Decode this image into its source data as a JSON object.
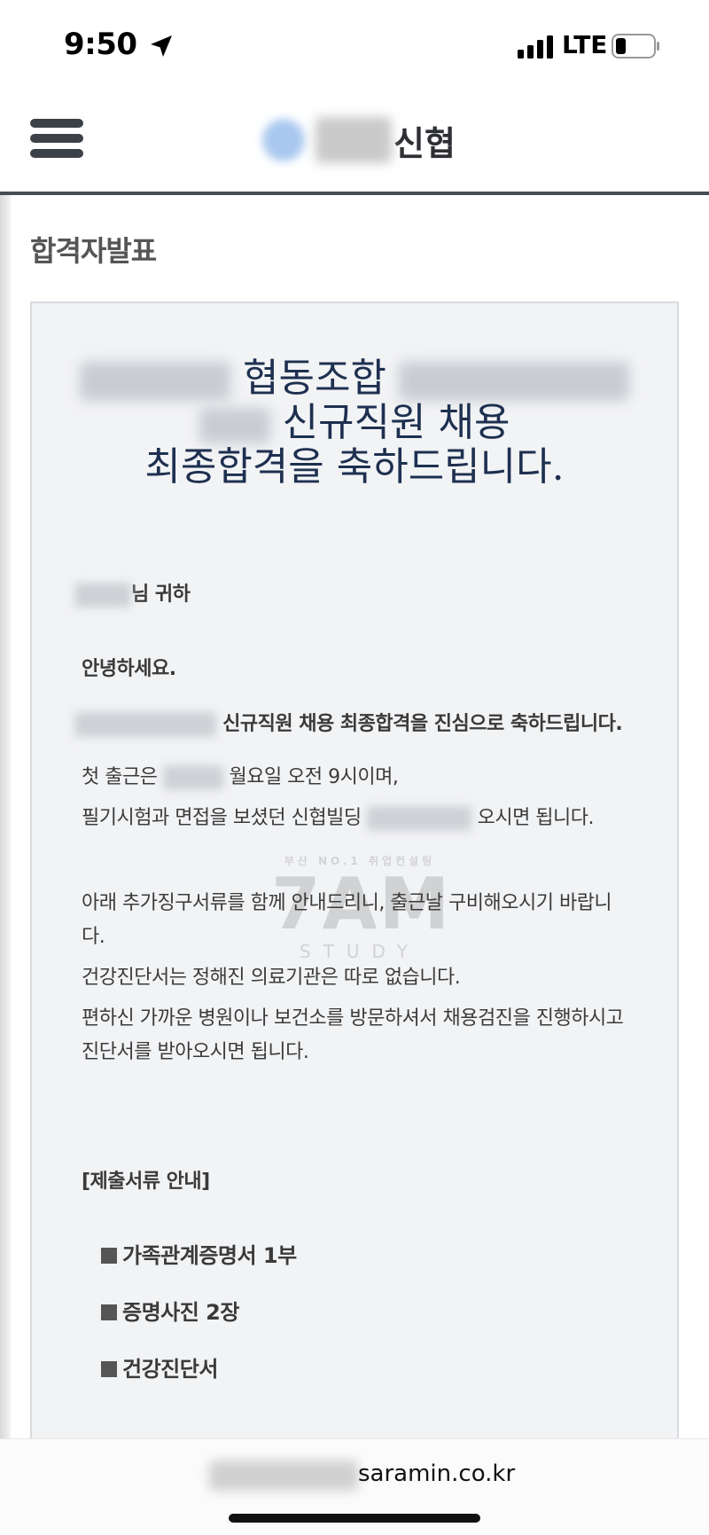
{
  "status_bar": {
    "time": "9:50",
    "network": "LTE",
    "icons": [
      "location-arrow-icon",
      "signal-bars-icon",
      "battery-icon"
    ]
  },
  "header": {
    "logo_text": "신협",
    "menu_icon": "hamburger-menu-icon"
  },
  "page": {
    "title": "합격자발표"
  },
  "notice": {
    "headline_line1": "협동조합",
    "headline_line2": "신규직원 채용",
    "headline_line3": "최종합격을 축하드립니다.",
    "recipient_suffix": "님 귀하",
    "greeting": "안녕하세요.",
    "congrats": "신규직원 채용 최종합격을 진심으로 축하드립니다.",
    "first_day_prefix": "첫 출근은",
    "first_day_suffix": "월요일 오전 9시이며,",
    "location_prefix": "필기시험과 면접을 보셨던 신협빌딩",
    "location_suffix": "오시면 됩니다.",
    "docs_intro_line1": "아래 추가징구서류를 함께 안내드리니, 출근날 구비해오시기 바랍니",
    "docs_intro_line2": "다.",
    "health_cert_1": "건강진단서는 정해진 의료기관은 따로 없습니다.",
    "health_cert_2_line1": "편하신 가까운 병원이나 보건소를 방문하셔서 채용검진을 진행하시고",
    "health_cert_2_line2": "진단서를 받아오시면 됩니다.",
    "docs_heading": "[제출서류 안내]",
    "docs": [
      "가족관계증명서 1부",
      "증명사진 2장",
      "건강진단서"
    ]
  },
  "watermark": {
    "top": "부산 NO.1 취업컨설팅",
    "mid": "7AM",
    "bottom": "STUDY"
  },
  "url_bar": {
    "domain": "saramin.co.kr"
  }
}
